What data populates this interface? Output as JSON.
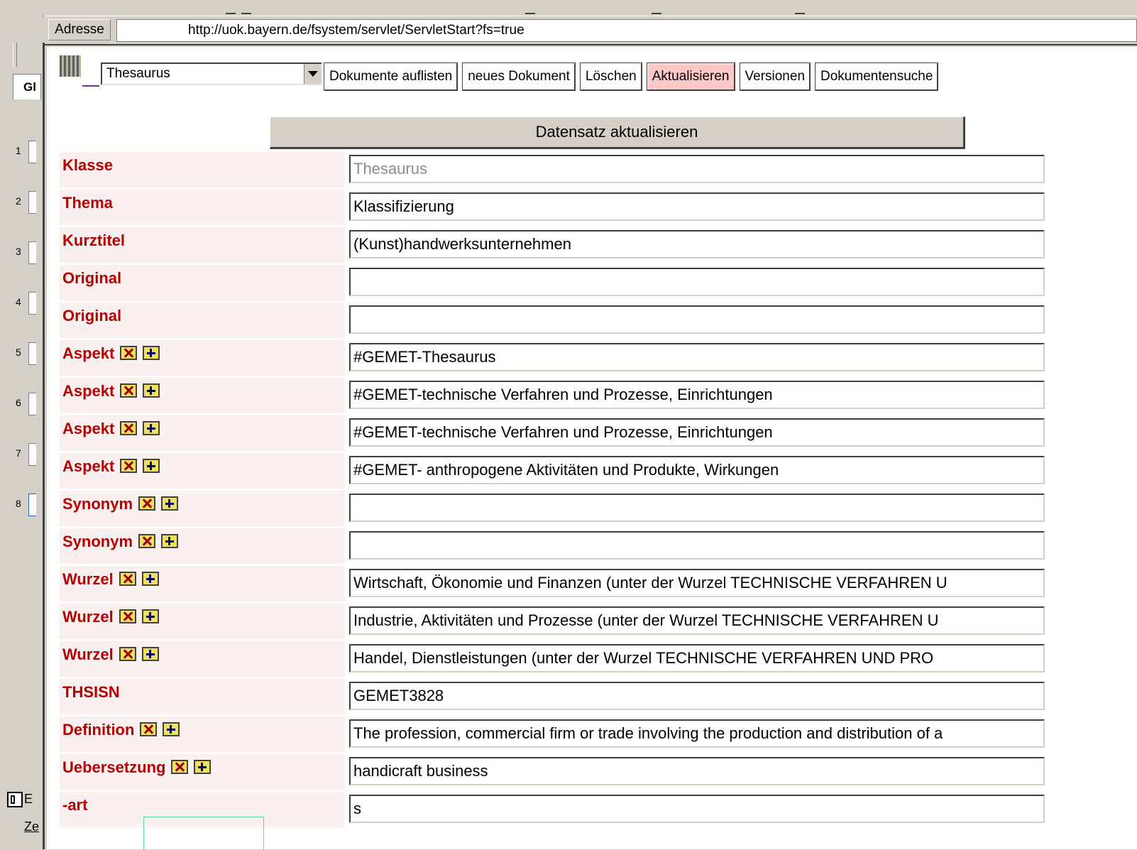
{
  "address": {
    "label": "Adresse",
    "url": "http://uok.bayern.de/fsystem/servlet/ServletStart?fs=true"
  },
  "left_panel": {
    "tab_label": "Gl",
    "numbers": [
      "1",
      "2",
      "3",
      "4",
      "5",
      "6",
      "7",
      "8"
    ],
    "bottom_label": "Ze",
    "bottom_label2": "E"
  },
  "toolbar": {
    "class_select_value": "Thesaurus",
    "buttons": [
      "Dokumente auflisten",
      "neues Dokument",
      "Löschen",
      "Aktualisieren",
      "Versionen",
      "Dokumentensuche"
    ],
    "active_button": "Aktualisieren",
    "active_color": "#ffc8c8"
  },
  "form": {
    "submit_label": "Datensatz aktualisieren",
    "label_color": "#b40000",
    "rows": [
      {
        "label": "Klasse",
        "value": "Thesaurus",
        "disabled": true,
        "buttons": false
      },
      {
        "label": "Thema",
        "value": "Klassifizierung",
        "buttons": false
      },
      {
        "label": "Kurztitel",
        "value": "(Kunst)handwerksunternehmen",
        "buttons": false
      },
      {
        "label": "Original",
        "value": "",
        "buttons": false
      },
      {
        "label": "Original",
        "value": "",
        "buttons": false
      },
      {
        "label": "Aspekt",
        "value": "#GEMET-Thesaurus",
        "buttons": true
      },
      {
        "label": "Aspekt",
        "value": "#GEMET-technische Verfahren und Prozesse, Einrichtungen",
        "buttons": true
      },
      {
        "label": "Aspekt",
        "value": "#GEMET-technische Verfahren und Prozesse, Einrichtungen",
        "buttons": true
      },
      {
        "label": "Aspekt",
        "value": "#GEMET- anthropogene Aktivitäten und Produkte, Wirkungen",
        "buttons": true
      },
      {
        "label": "Synonym",
        "value": "",
        "buttons": true
      },
      {
        "label": "Synonym",
        "value": "",
        "buttons": true
      },
      {
        "label": "Wurzel",
        "value": "Wirtschaft, Ökonomie und Finanzen (unter der Wurzel TECHNISCHE VERFAHREN U",
        "buttons": true
      },
      {
        "label": "Wurzel",
        "value": "Industrie, Aktivitäten und Prozesse (unter der Wurzel TECHNISCHE VERFAHREN U",
        "buttons": true
      },
      {
        "label": "Wurzel",
        "value": "Handel, Dienstleistungen (unter der Wurzel TECHNISCHE VERFAHREN UND PRO",
        "buttons": true
      },
      {
        "label": "THSISN",
        "value": "GEMET3828",
        "buttons": false
      },
      {
        "label": "Definition",
        "value": "The profession, commercial firm or trade involving the production and distribution of a",
        "buttons": true
      },
      {
        "label": "Uebersetzung",
        "value": "handicraft business",
        "buttons": true
      },
      {
        "label": "-art",
        "value": "s",
        "buttons": false
      }
    ]
  },
  "icons": {
    "row_delete": "delete-x-icon",
    "row_add": "add-plus-icon",
    "doc_type": "document-type-icon",
    "dropdown": "chevron-down-icon"
  }
}
